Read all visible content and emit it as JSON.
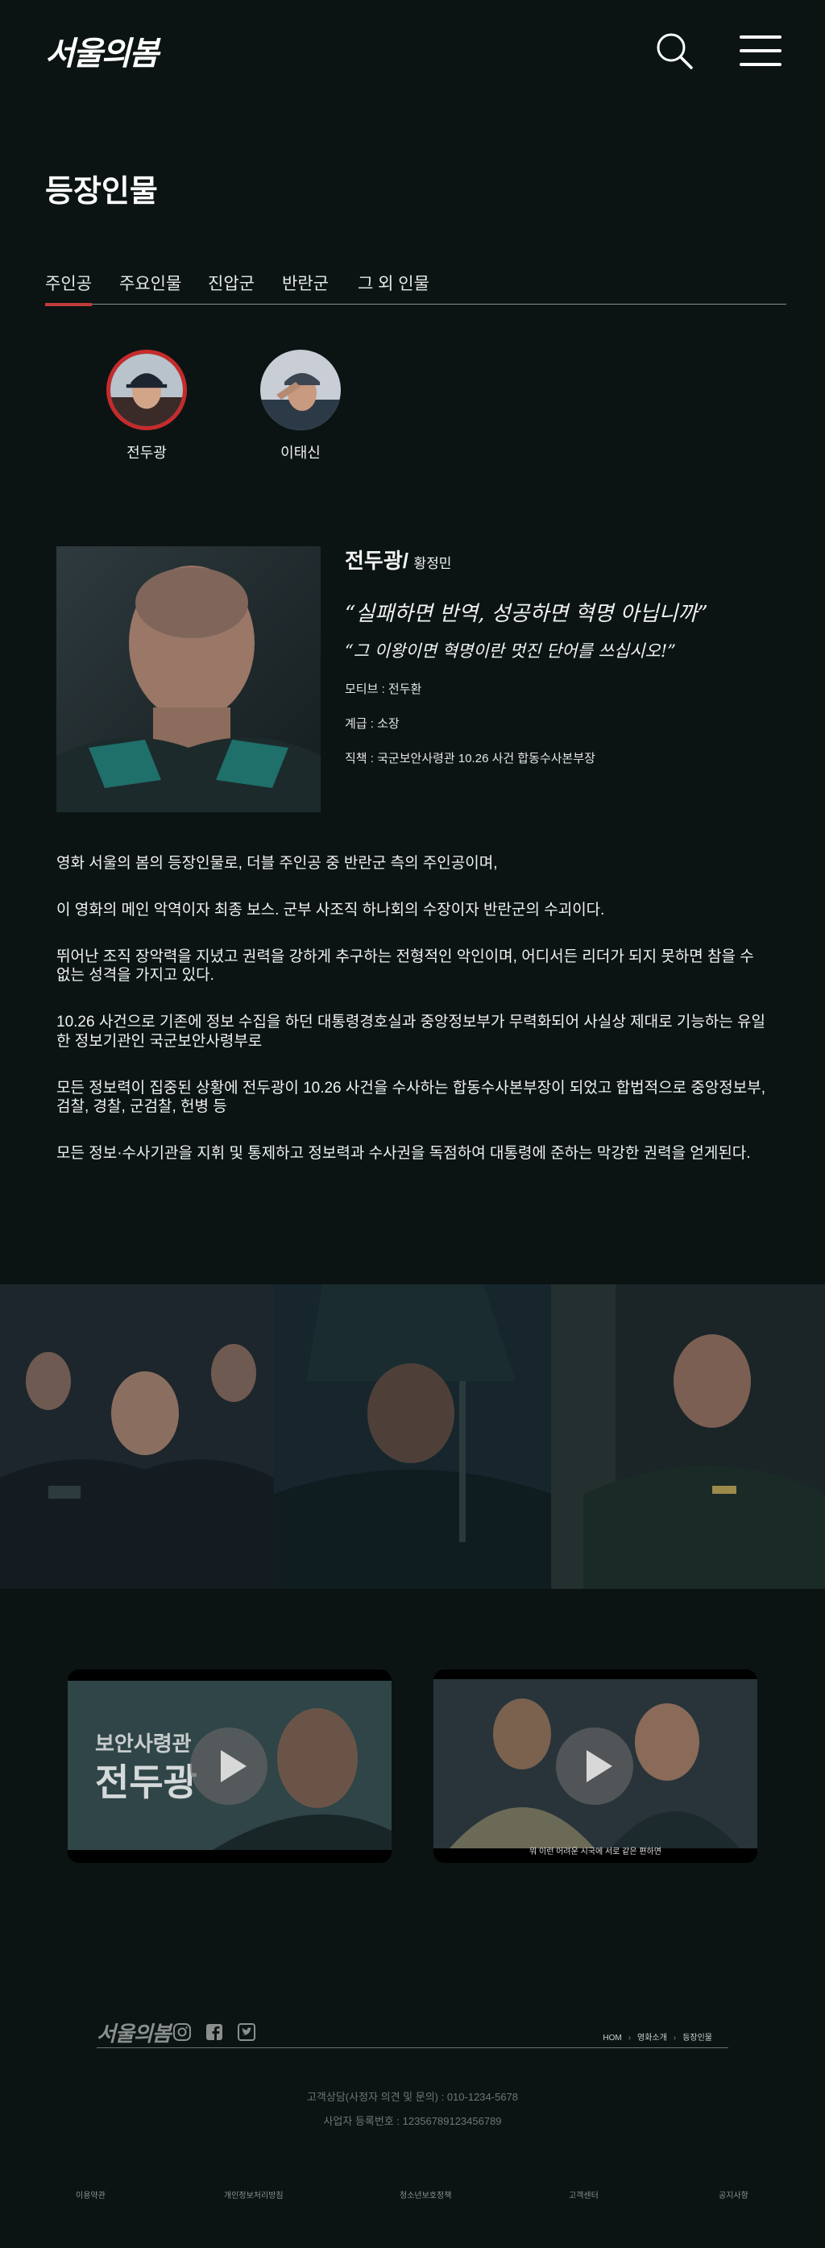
{
  "header": {
    "logo_text": "서울의봄",
    "search_icon": "search-icon",
    "menu_icon": "hamburger-menu-icon"
  },
  "page": {
    "title": "등장인물"
  },
  "tabs": [
    {
      "label": "주인공",
      "active": true
    },
    {
      "label": "주요인물",
      "active": false
    },
    {
      "label": "진압군",
      "active": false
    },
    {
      "label": "반란군",
      "active": false
    },
    {
      "label": "그 외 인물",
      "active": false
    }
  ],
  "characters": [
    {
      "name": "전두광",
      "selected": true
    },
    {
      "name": "이태신",
      "selected": false
    }
  ],
  "profile": {
    "name": "전두광/",
    "actor": "황정민",
    "quote1": "“실패하면 반역, 성공하면 혁명 아닙니까”",
    "quote2": "“그 이왕이면 혁명이란 멋진 단어를 쓰십시오!”",
    "motive": "모티브 : 전두환",
    "rank": "계급 : 소장",
    "position": "직책 : 국군보안사령관 10.26 사건 합동수사본부장"
  },
  "description": [
    "영화 서울의 봄의 등장인물로, 더블 주인공 중 반란군 측의 주인공이며,",
    "이 영화의 메인 악역이자 최종 보스. 군부 사조직 하나회의 수장이자 반란군의 수괴이다.",
    "뛰어난 조직 장악력을 지녔고 권력을 강하게 추구하는 전형적인 악인이며, 어디서든 리더가 되지 못하면 참을 수 없는 성격을 가지고 있다.",
    "10.26 사건으로 기존에 정보 수집을 하던 대통령경호실과 중앙정보부가 무력화되어 사실상 제대로 기능하는 유일한 정보기관인 국군보안사령부로",
    "모든 정보력이 집중된 상황에 전두광이 10.26 사건을 수사하는 합동수사본부장이 되었고 합법적으로 중앙정보부, 검찰, 경찰, 군검찰, 헌병 등",
    "모든 정보·수사기관을 지휘 및 통제하고 정보력과 수사권을 독점하여 대통령에 준하는 막강한 권력을 얻게된다."
  ],
  "videos": [
    {
      "title_line1": "보안사령관",
      "title_line2": "전두광",
      "caption": ""
    },
    {
      "title_line1": "",
      "title_line2": "",
      "caption": "뭐 이런 어려운 시국에 서로 같은 편하면"
    }
  ],
  "footer": {
    "logo_text": "서울의봄",
    "social_icons": [
      "instagram-icon",
      "facebook-icon",
      "twitter-icon"
    ],
    "breadcrumb": [
      "HOM",
      "영화소개",
      "등장인물"
    ],
    "contact": "고객상담(사정자 의견 및 문의) : 010-1234-5678",
    "business": "사업자 등록번호 : 12356789123456789",
    "links": [
      "이용약관",
      "개인정보처리방침",
      "청소년보호정책",
      "고객센터",
      "공지사항"
    ]
  },
  "colors": {
    "background": "#0b1413",
    "accent": "#c62b2b",
    "text": "#f2f2f2"
  }
}
